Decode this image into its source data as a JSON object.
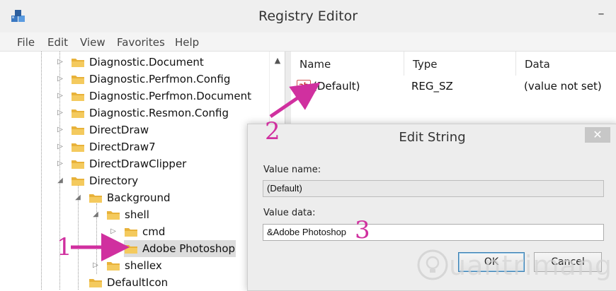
{
  "window": {
    "title": "Registry Editor",
    "minimize_glyph": "–"
  },
  "menu": [
    "File",
    "Edit",
    "View",
    "Favorites",
    "Help"
  ],
  "tree": {
    "items": [
      {
        "label": "Diagnostic.Document"
      },
      {
        "label": "Diagnostic.Perfmon.Config"
      },
      {
        "label": "Diagnostic.Perfmon.Document"
      },
      {
        "label": "Diagnostic.Resmon.Config"
      },
      {
        "label": "DirectDraw"
      },
      {
        "label": "DirectDraw7"
      },
      {
        "label": "DirectDrawClipper"
      },
      {
        "label": "Directory"
      },
      {
        "label": "Background"
      },
      {
        "label": "shell"
      },
      {
        "label": "cmd"
      },
      {
        "label": "Adobe Photoshop"
      },
      {
        "label": "shellex"
      },
      {
        "label": "DefaultIcon"
      }
    ],
    "selected": "Adobe Photoshop"
  },
  "list": {
    "columns": [
      "Name",
      "Type",
      "Data"
    ],
    "rows": [
      {
        "icon_text": "ab",
        "name": "(Default)",
        "type": "REG_SZ",
        "data": "(value not set)"
      }
    ]
  },
  "dialog": {
    "title": "Edit String",
    "close_glyph": "✕",
    "value_name_label": "Value name:",
    "value_name": "(Default)",
    "value_data_label": "Value data:",
    "value_data": "&Adobe Photoshop",
    "ok_label": "OK",
    "cancel_label": "Cancel"
  },
  "annotations": {
    "step1": "1",
    "step2": "2",
    "step3": "3",
    "color": "#d0309f"
  },
  "watermark": "uantrimang",
  "colors": {
    "folder": "#e8b23a",
    "accent": "#d0309f",
    "selected": "#dcdcdc"
  }
}
